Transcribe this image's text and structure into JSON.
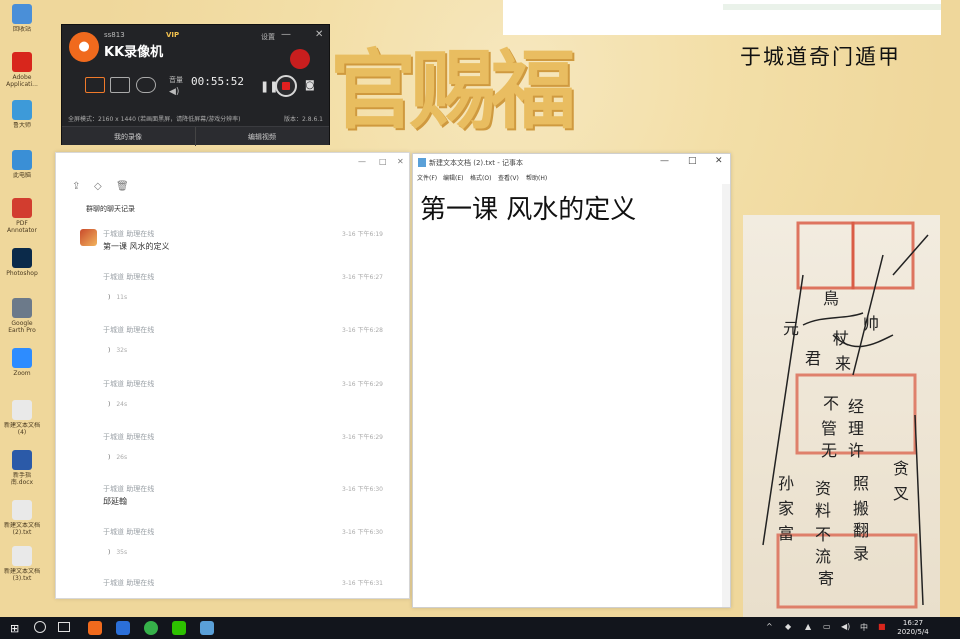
{
  "desktop": {
    "overlay_title": "于城道奇门遁甲",
    "wallpaper_calligraphy": "官赐福",
    "icons": [
      {
        "label": "回收站",
        "icon": "recycle-bin-icon",
        "color": "#4a8fd8"
      },
      {
        "label": "Adobe Applicati...",
        "icon": "adobe-icon",
        "color": "#d8261c"
      },
      {
        "label": "鲁大师",
        "icon": "ludashi-icon",
        "color": "#3d9ad9"
      },
      {
        "label": "此电脑",
        "icon": "computer-icon",
        "color": "#3a8fd6"
      },
      {
        "label": "PDF Annotator",
        "icon": "pdf-annotator-icon",
        "color": "#d23d2f"
      },
      {
        "label": "Photoshop",
        "icon": "photoshop-icon",
        "color": "#0b2a4a"
      },
      {
        "label": "Google Earth Pro",
        "icon": "google-earth-icon",
        "color": "#6c7a8a"
      },
      {
        "label": "Zoom",
        "icon": "zoom-icon",
        "color": "#2d8cff"
      },
      {
        "label": "新建文本文档 (4)",
        "icon": "text-file-icon",
        "color": "#e9e9e9"
      },
      {
        "label": "新手指南.docx",
        "icon": "word-doc-icon",
        "color": "#2b5aa8"
      },
      {
        "label": "新建文本文档(2).txt",
        "icon": "text-file-icon",
        "color": "#e9e9e9"
      },
      {
        "label": "新建文本文档(3).txt",
        "icon": "text-file-icon",
        "color": "#e9e9e9"
      }
    ]
  },
  "kk": {
    "username": "ss813",
    "vip": "VIP",
    "brand": "KK录像机",
    "settings": "设置",
    "volume_label": "音量",
    "timer": "00:55:52",
    "info": "全屏模式：2160 x 1440 (若画面黑屏，请降低屏幕/游戏分辨率)",
    "version": "版本：2.8.6.1",
    "footer_left": "我的录像",
    "footer_right": "编辑视频"
  },
  "chat": {
    "history_title": "群聊的聊天记录",
    "messages": [
      {
        "sender": "于城道 助理在线",
        "time": "3-16 下午6:19",
        "text": "第一课 风水的定义",
        "voice": ""
      },
      {
        "sender": "于城道 助理在线",
        "time": "3-16 下午6:27",
        "text": "",
        "voice": "11s"
      },
      {
        "sender": "于城道 助理在线",
        "time": "3-16 下午6:28",
        "text": "",
        "voice": "32s"
      },
      {
        "sender": "于城道 助理在线",
        "time": "3-16 下午6:29",
        "text": "",
        "voice": "24s"
      },
      {
        "sender": "于城道 助理在线",
        "time": "3-16 下午6:29",
        "text": "",
        "voice": "26s"
      },
      {
        "sender": "于城道 助理在线",
        "time": "3-16 下午6:30",
        "text": "邱延翰",
        "voice": ""
      },
      {
        "sender": "于城道 助理在线",
        "time": "3-16 下午6:30",
        "text": "",
        "voice": "35s"
      },
      {
        "sender": "于城道 助理在线",
        "time": "3-16 下午6:31",
        "text": "",
        "voice": ""
      }
    ]
  },
  "notepad": {
    "title": "新建文本文档 (2).txt - 记事本",
    "menu": [
      "文件(F)",
      "编辑(E)",
      "格式(O)",
      "查看(V)",
      "帮助(H)"
    ],
    "content": "第一课 风水的定义"
  },
  "photo": {
    "handwriting": [
      "鳥",
      "元",
      "帅",
      "杖",
      "君",
      "来",
      "不",
      "经",
      "管",
      "理",
      "无",
      "许",
      "资",
      "照",
      "料",
      "搬",
      "不",
      "翻",
      "流",
      "录",
      "寄",
      "贪",
      "叉",
      "孙",
      "家",
      "富"
    ]
  },
  "taskbar": {
    "ime": "中",
    "time": "16:27",
    "date": "2020/5/4"
  }
}
